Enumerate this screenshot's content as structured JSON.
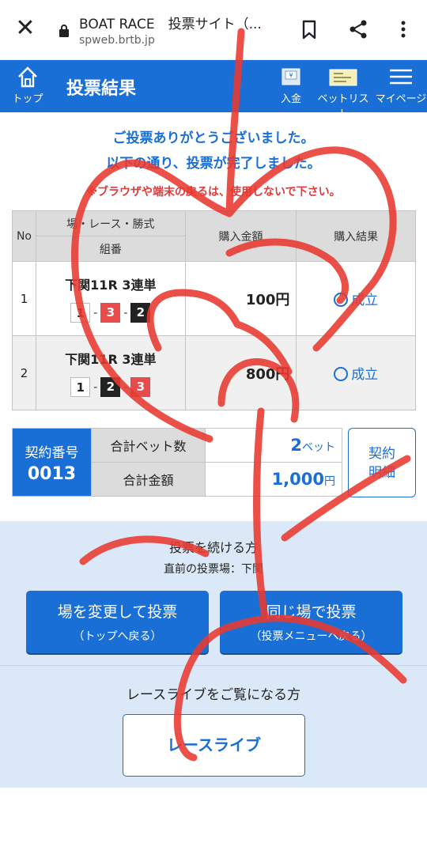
{
  "browser": {
    "title": "BOAT RACE　投票サイト（...",
    "url": "spweb.brtb.jp"
  },
  "header": {
    "top_label": "トップ",
    "page_title": "投票結果",
    "deposit_label": "入金",
    "betlist_label": "ベットリスト",
    "mypage_label": "マイページ"
  },
  "message": {
    "line1": "ご投票ありがとうございました。",
    "line2": "以下の通り、投票が完了しました。",
    "warning": "※ブラウザや端末の戻るは、使用しないで下さい。"
  },
  "bets": {
    "columns": {
      "no": "No",
      "race_type": "場・レース・勝式",
      "combination": "組番",
      "amount": "購入金額",
      "result": "購入結果"
    },
    "rows": [
      {
        "no": "1",
        "race": "下関11R 3連単",
        "boxes": [
          "1",
          "3",
          "2"
        ],
        "amount": "100円",
        "result": "成立"
      },
      {
        "no": "2",
        "race": "下関11R 3連単",
        "boxes": [
          "1",
          "2",
          "3"
        ],
        "amount": "800円",
        "result": "成立"
      }
    ]
  },
  "summary": {
    "contract_label": "契約番号",
    "contract_number": "0013",
    "total_bets_label": "合計ベット数",
    "total_bets_value": "2",
    "total_bets_unit": "ベット",
    "total_amount_label": "合計金額",
    "total_amount_value": "1,000",
    "total_amount_unit": "円",
    "detail_button_line1": "契約",
    "detail_button_line2": "明細"
  },
  "continue": {
    "title": "投票を続ける方",
    "previous_venue": "直前の投票場：下関",
    "change_main": "場を変更して投票",
    "change_sub": "（トップへ戻る）",
    "same_main": "同じ場で投票",
    "same_sub": "（投票メニューへ戻る）"
  },
  "live": {
    "title": "レースライブをご覧になる方",
    "button": "レースライブ"
  },
  "colors": {
    "brand_blue": "#1a6fd6",
    "warning_red": "#e03a3a",
    "box_red": "#e84b4b",
    "scribble_red": "#e8392f"
  }
}
